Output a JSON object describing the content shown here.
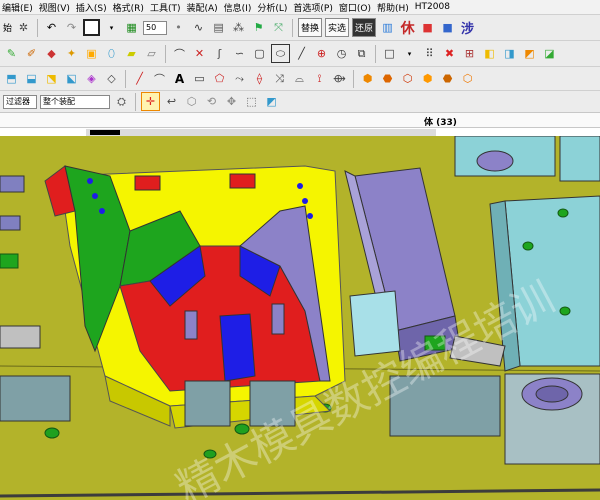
{
  "menu": [
    "编辑(E)",
    "视图(V)",
    "插入(S)",
    "格式(R)",
    "工具(T)",
    "装配(A)",
    "信息(I)",
    "分析(L)",
    "首选项(P)",
    "窗口(O)",
    "帮助(H)",
    "HT2008"
  ],
  "toolbar": {
    "edit_label": "始",
    "layer_value": "50",
    "btn_replace": "替换",
    "btn_solid": "实选",
    "btn_restore": "还原",
    "btn_body": "休",
    "btn_step": "涉"
  },
  "filter": {
    "type_filter": "过滤器",
    "scope": "整个装配"
  },
  "viewport": {
    "title": "体 (33)",
    "watermark": "精木模具数控编程培训"
  },
  "colors": {
    "background": "#b3b32a",
    "core": "#f5f500",
    "red": "#e01e1e",
    "blue": "#1e1ee6",
    "green": "#1ea51e",
    "purple": "#8c82c8",
    "plate": "#8cd2d7"
  }
}
